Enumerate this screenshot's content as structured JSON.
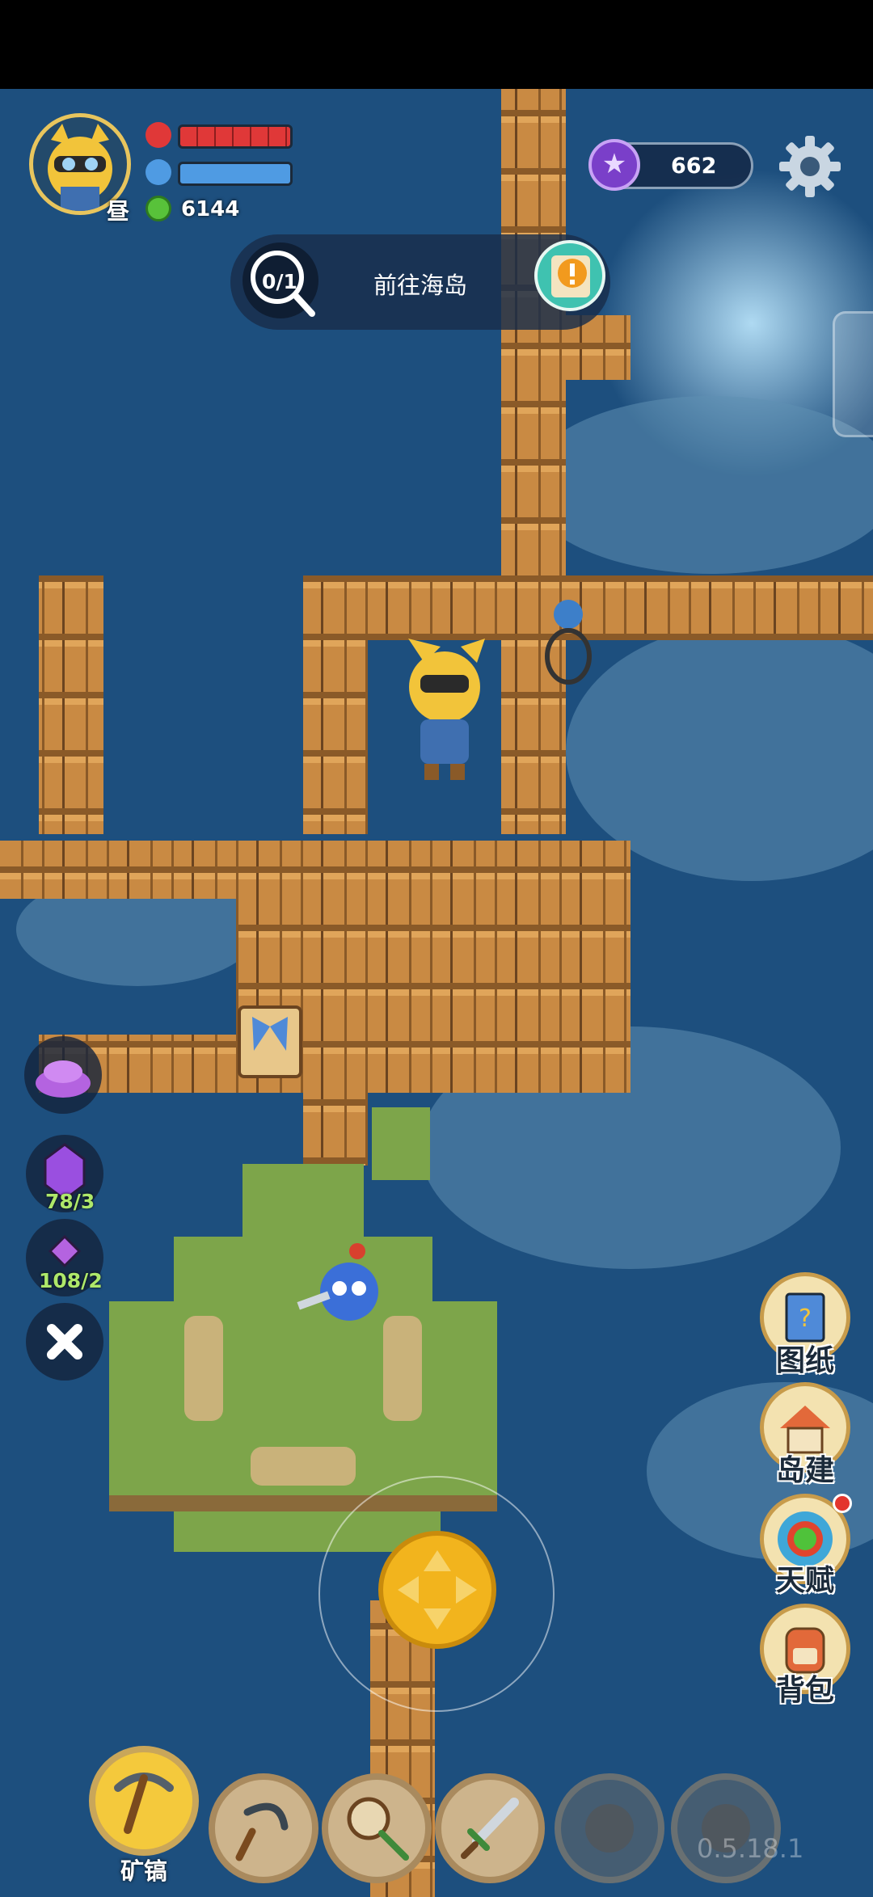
{
  "player": {
    "time_of_day_label": "昼",
    "coins": "6144",
    "icons": {
      "avatar": "fox-goggles-avatar",
      "hp": "heart-icon",
      "mp": "water-drop-icon",
      "coin": "green-coin-icon"
    }
  },
  "currency": {
    "gems": "662",
    "icon": "purple-star-gem-icon"
  },
  "quest": {
    "progress": "0/1",
    "text": "前往海岛"
  },
  "resources": [
    {
      "icon": "purple-ore-pile-icon",
      "text": ""
    },
    {
      "icon": "purple-crystal-icon",
      "text": "78/3"
    },
    {
      "icon": "purple-shard-icon",
      "text": "108/2"
    }
  ],
  "menu": {
    "blueprint": "图纸",
    "island_build": "岛建",
    "talent": "天赋",
    "backpack": "背包"
  },
  "toolbar": {
    "active_label": "矿镐",
    "slots": [
      "pickaxe",
      "sickle",
      "bug-net",
      "sword",
      "locked",
      "locked"
    ]
  },
  "version": "0.5.18.1",
  "colors": {
    "sea": "#1d4f7e",
    "wood": "#c98a43",
    "grass": "#7da54a",
    "accent": "#f2b41d",
    "hp": "#e03838",
    "mp": "#4f9be3"
  }
}
